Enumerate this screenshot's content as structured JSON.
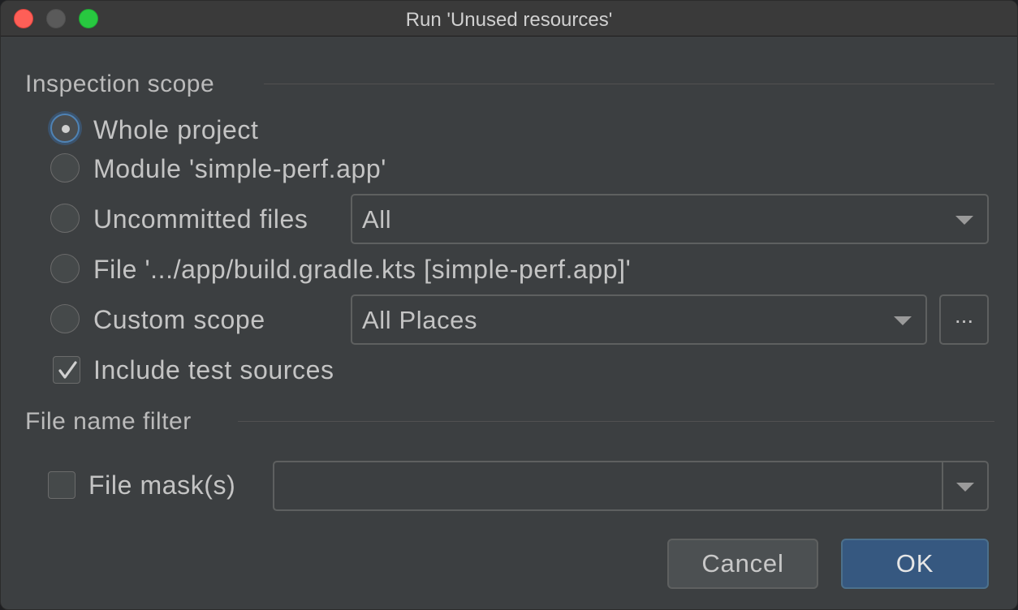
{
  "window": {
    "title": "Run 'Unused resources'"
  },
  "inspection_scope": {
    "title": "Inspection scope",
    "options": [
      {
        "label": "Whole project",
        "selected": true
      },
      {
        "label": "Module 'simple-perf.app'",
        "selected": false
      },
      {
        "label": "Uncommitted files",
        "selected": false
      },
      {
        "label": "File '.../app/build.gradle.kts [simple-perf.app]'",
        "selected": false
      },
      {
        "label": "Custom scope",
        "selected": false
      }
    ],
    "uncommitted_value": "All",
    "custom_scope_value": "All Places",
    "browse_label": "...",
    "include_test_sources": {
      "label": "Include test sources",
      "checked": true
    }
  },
  "file_name_filter": {
    "title": "File name filter",
    "file_masks": {
      "label": "File mask(s)",
      "checked": false,
      "value": ""
    }
  },
  "buttons": {
    "cancel": "Cancel",
    "ok": "OK"
  },
  "colors": {
    "accent": "#365880",
    "background": "#3c3f41",
    "focus_ring": "#4f83b5"
  }
}
